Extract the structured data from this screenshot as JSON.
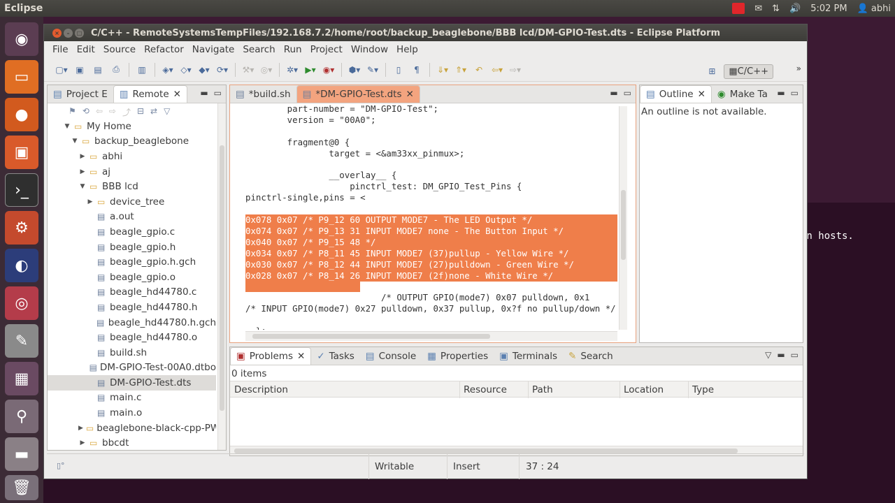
{
  "topbar": {
    "app_name": "Eclipse",
    "clock": "5:02 PM",
    "user": "abhi"
  },
  "window": {
    "title": "C/C++ - RemoteSystemsTempFiles/192.168.7.2/home/root/backup_beaglebone/BBB lcd/DM-GPIO-Test.dts - Eclipse Platform"
  },
  "menu": [
    "File",
    "Edit",
    "Source",
    "Refactor",
    "Navigate",
    "Search",
    "Run",
    "Project",
    "Window",
    "Help"
  ],
  "perspective": {
    "label": "C/C++"
  },
  "left_panel": {
    "tabs": [
      "Project E",
      "Remote"
    ],
    "tree": [
      {
        "label": "My Home",
        "level": 0,
        "type": "home",
        "expanded": true
      },
      {
        "label": "backup_beaglebone",
        "level": 1,
        "type": "folder",
        "expanded": true
      },
      {
        "label": "abhi",
        "level": 2,
        "type": "folder",
        "expanded": false
      },
      {
        "label": "aj",
        "level": 2,
        "type": "folder",
        "expanded": false
      },
      {
        "label": "BBB lcd",
        "level": 2,
        "type": "folder",
        "expanded": true
      },
      {
        "label": "device_tree",
        "level": 3,
        "type": "folder",
        "expanded": false
      },
      {
        "label": "a.out",
        "level": 3,
        "type": "file"
      },
      {
        "label": "beagle_gpio.c",
        "level": 3,
        "type": "file"
      },
      {
        "label": "beagle_gpio.h",
        "level": 3,
        "type": "file"
      },
      {
        "label": "beagle_gpio.h.gch",
        "level": 3,
        "type": "file"
      },
      {
        "label": "beagle_gpio.o",
        "level": 3,
        "type": "file"
      },
      {
        "label": "beagle_hd44780.c",
        "level": 3,
        "type": "file"
      },
      {
        "label": "beagle_hd44780.h",
        "level": 3,
        "type": "file"
      },
      {
        "label": "beagle_hd44780.h.gch",
        "level": 3,
        "type": "file"
      },
      {
        "label": "beagle_hd44780.o",
        "level": 3,
        "type": "file"
      },
      {
        "label": "build.sh",
        "level": 3,
        "type": "file"
      },
      {
        "label": "DM-GPIO-Test-00A0.dtbo",
        "level": 3,
        "type": "file"
      },
      {
        "label": "DM-GPIO-Test.dts",
        "level": 3,
        "type": "file",
        "selected": true
      },
      {
        "label": "main.c",
        "level": 3,
        "type": "file"
      },
      {
        "label": "main.o",
        "level": 3,
        "type": "file"
      },
      {
        "label": "beaglebone-black-cpp-PWM",
        "level": 2,
        "type": "folder",
        "expanded": false
      },
      {
        "label": "bbcdt",
        "level": 2,
        "type": "folder",
        "expanded": false
      }
    ]
  },
  "editor": {
    "tabs": [
      "*build.sh",
      "*DM-GPIO-Test.dts"
    ],
    "lines": [
      "        part-number = \"DM-GPIO-Test\";",
      "        version = \"00A0\";",
      "",
      "        fragment@0 {",
      "                target = <&am33xx_pinmux>;",
      "",
      "                __overlay__ {",
      "                    pinctrl_test: DM_GPIO_Test_Pins {",
      "pinctrl-single,pins = <",
      "",
      "0x078 0x07 /* P9_12 60 OUTPUT MODE7 - The LED Output */",
      "0x074 0x07 /* P9_13 31 INPUT MODE7 none - The Button Input */",
      "0x040 0x07 /* P9_15 48 */",
      "0x034 0x07 /* P8_11 45 INPUT MODE7 (37)pullup - Yellow Wire */",
      "0x030 0x07 /* P8_12 44 INPUT MODE7 (27)pulldown - Green Wire */",
      "0x028 0x07 /* P8_14 26 INPUT MODE7 (2f)none - White Wire */",
      "                          ",
      "                          /* OUTPUT GPIO(mode7) 0x07 pulldown, 0x1",
      "/* INPUT GPIO(mode7) 0x27 pulldown, 0x37 pullup, 0x?f no pullup/down */",
      "",
      "  };"
    ]
  },
  "outline_panel": {
    "tabs": [
      "Outline",
      "Make Ta"
    ],
    "message": "An outline is not available."
  },
  "bottom_panel": {
    "tabs": [
      "Problems",
      "Tasks",
      "Console",
      "Properties",
      "Terminals",
      "Search"
    ],
    "count": "0 items",
    "columns": [
      "Description",
      "Resource",
      "Path",
      "Location",
      "Type"
    ]
  },
  "statusbar": {
    "mode": "Writable",
    "insert": "Insert",
    "position": "37 : 24"
  },
  "desktop": {
    "terminal_text": "wn hosts."
  }
}
